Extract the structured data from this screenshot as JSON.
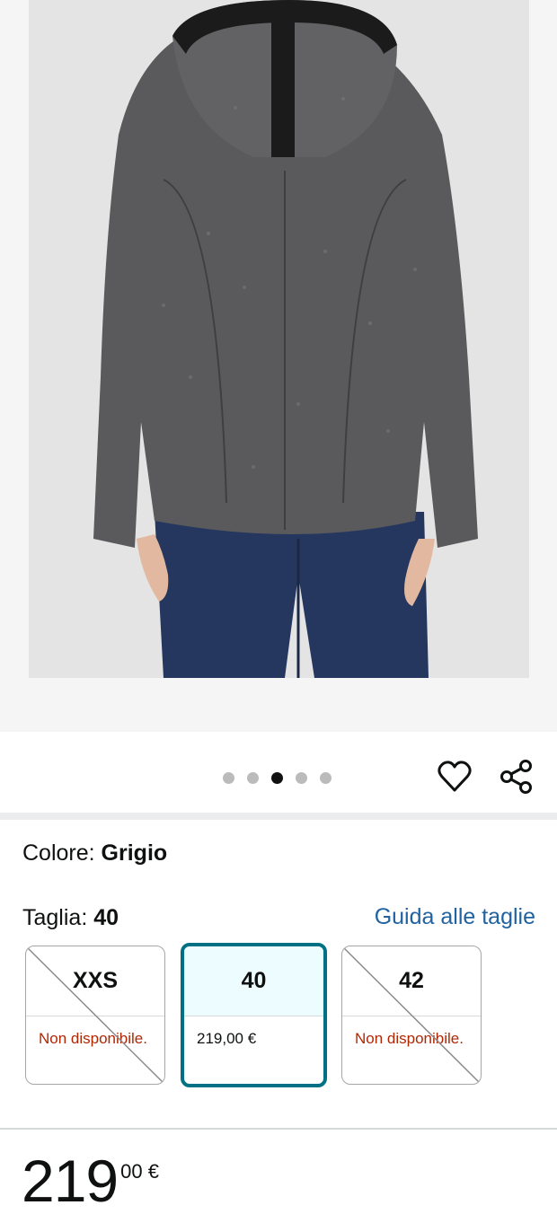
{
  "product": {
    "color_label": "Colore:",
    "color_value": "Grigio",
    "size_label": "Taglia:",
    "size_value": "40",
    "size_guide_link": "Guida alle taglie"
  },
  "gallery": {
    "image_count": 5,
    "active_index": 2
  },
  "sizes": [
    {
      "label": "XXS",
      "status": "Non disponibile.",
      "available": false
    },
    {
      "label": "40",
      "price": "219,00 €",
      "available": true,
      "selected": true
    },
    {
      "label": "42",
      "status": "Non disponibile.",
      "available": false
    }
  ],
  "price": {
    "whole": "219",
    "fraction": "00 €"
  },
  "colors": {
    "accent": "#007185",
    "link": "#2162a1",
    "unavailable": "#b12704",
    "selected_bg": "#edfdff"
  },
  "icons": {
    "wishlist": "heart-icon",
    "share": "share-icon"
  }
}
